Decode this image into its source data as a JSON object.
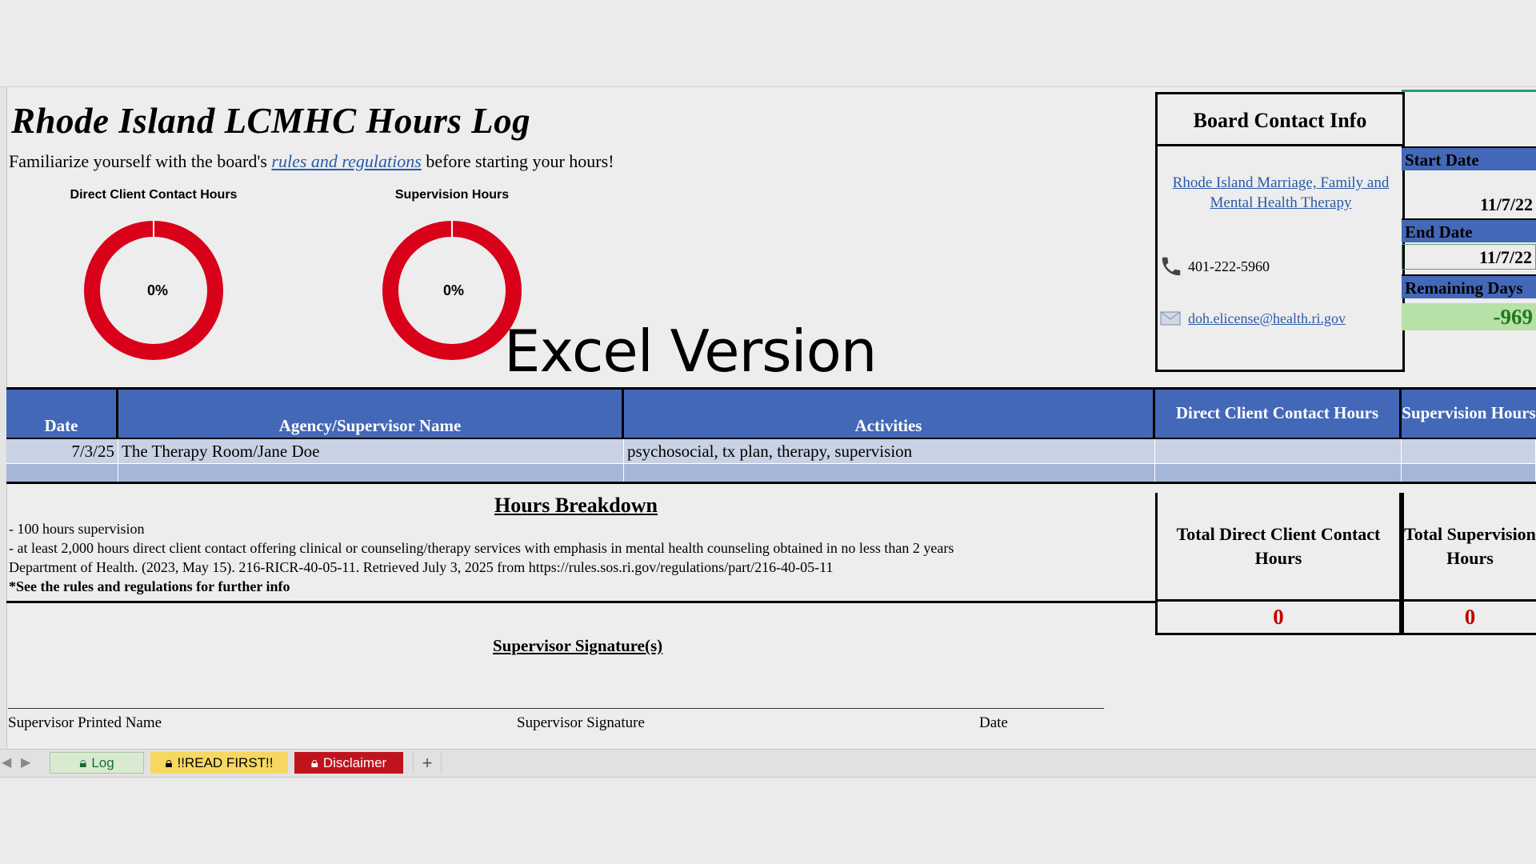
{
  "title": "Rhode Island LCMHC Hours Log",
  "subtitle": {
    "before": "Familiarize yourself with the board's ",
    "link": "rules and regulations",
    "after": " before starting your hours!"
  },
  "donuts": [
    {
      "title": "Direct Client Contact Hours",
      "label": "0%",
      "value": 0
    },
    {
      "title": "Supervision Hours",
      "label": "0%",
      "value": 0
    }
  ],
  "overlay_text": "Excel Version",
  "contact": {
    "heading": "Board Contact Info",
    "board_link": "Rhode Island Marriage, Family and Mental Health Therapy",
    "phone": "401-222-5960",
    "email": "doh.elicense@health.ri.gov"
  },
  "dates": {
    "start_label": "Start Date",
    "start_value": "11/7/22",
    "end_label": "End Date",
    "end_value": "11/7/22",
    "remaining_label": "Remaining Days",
    "remaining_value": "-969"
  },
  "table": {
    "headers": [
      "Date",
      "Agency/Supervisor Name",
      "Activities",
      "Direct Client Contact Hours",
      "Supervision Hours"
    ],
    "rows": [
      [
        "7/3/25",
        "The Therapy Room/Jane Doe",
        "psychosocial, tx plan, therapy, supervision",
        "",
        ""
      ],
      [
        "",
        "",
        "",
        "",
        ""
      ]
    ]
  },
  "breakdown": {
    "title": "Hours Breakdown",
    "lines": [
      "- 100 hours supervision",
      "- at least 2,000 hours direct client contact offering clinical or counseling/therapy services with emphasis in mental health counseling obtained in no less than 2 years",
      "Department of Health. (2023, May 15). 216-RICR-40-05-11. Retrieved July 3, 2025 from https://rules.sos.ri.gov/regulations/part/216-40-05-11",
      "*See the rules and regulations for further info"
    ]
  },
  "totals": {
    "direct_label": "Total Direct Client Contact Hours",
    "supervision_label": "Total Supervision Hours",
    "direct_value": "0",
    "supervision_value": "0"
  },
  "signature": {
    "title": "Supervisor Signature(s)",
    "printed_name": "Supervisor Printed Name",
    "sig": "Supervisor Signature",
    "date": "Date"
  },
  "tabs": [
    {
      "label": "Log",
      "bg": "#d9ead3",
      "fg": "#1e6b2e"
    },
    {
      "label": "!!READ FIRST!!",
      "bg": "#f6d860",
      "fg": "#000000"
    },
    {
      "label": "Disclaimer",
      "bg": "#c0141c",
      "fg": "#ffffff"
    }
  ],
  "add_tab": "+",
  "colors": {
    "header_blue": "#4468b8",
    "donut_red": "#d9001a",
    "total_red": "#c00000",
    "remaining_green": "#b7e1a6"
  }
}
